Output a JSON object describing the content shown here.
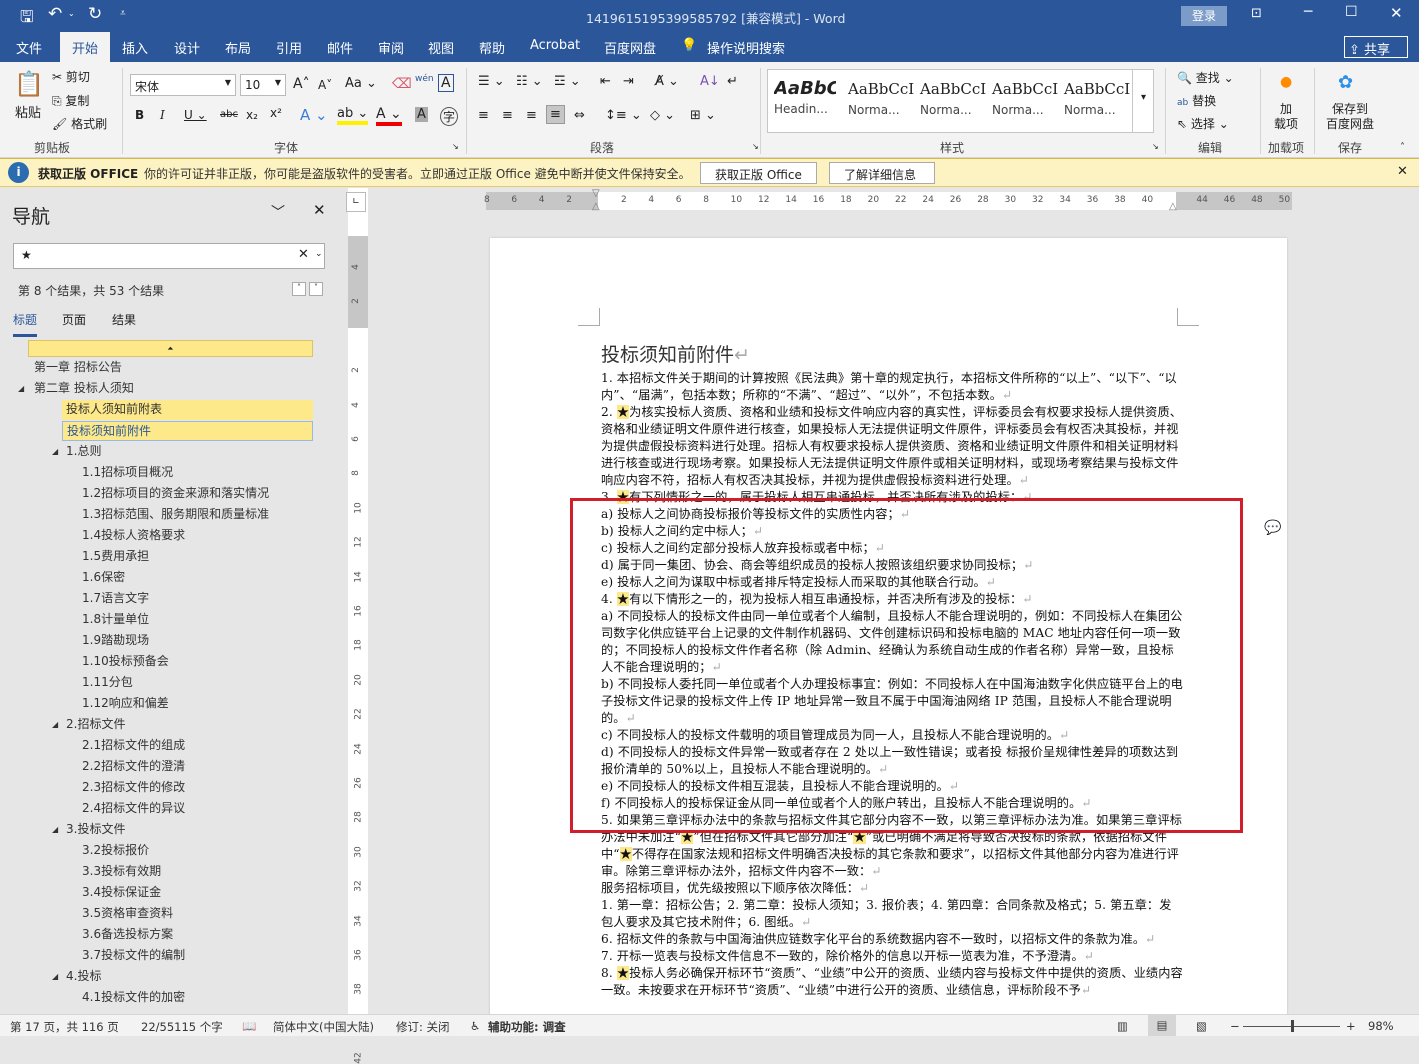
{
  "titlebar": {
    "doc_title": "1419615195399585792 [兼容模式]  -  Word",
    "login": "登录"
  },
  "tabs": [
    "文件",
    "开始",
    "插入",
    "设计",
    "布局",
    "引用",
    "邮件",
    "审阅",
    "视图",
    "帮助",
    "Acrobat",
    "百度网盘"
  ],
  "tell_me": "操作说明搜索",
  "share": "共享",
  "ribbon": {
    "clipboard": {
      "paste": "粘贴",
      "cut": "剪切",
      "copy": "复制",
      "format_painter": "格式刷",
      "label": "剪贴板"
    },
    "font": {
      "name": "宋体",
      "size": "10",
      "label": "字体",
      "aa": "Aa",
      "wen": "wén"
    },
    "paragraph": {
      "label": "段落"
    },
    "styles": {
      "label": "样式",
      "items": [
        {
          "preview": "AaBbC",
          "name": "Headin..."
        },
        {
          "preview": "AaBbCcI",
          "name": "Norma..."
        },
        {
          "preview": "AaBbCcI",
          "name": "Norma..."
        },
        {
          "preview": "AaBbCcI",
          "name": "Norma..."
        },
        {
          "preview": "AaBbCcI",
          "name": "Norma..."
        }
      ]
    },
    "editing": {
      "find": "查找",
      "replace": "替换",
      "select": "选择",
      "label": "编辑"
    },
    "addins": {
      "button": "加\n载项",
      "label": "加载项"
    },
    "save": {
      "button": "保存到\n百度网盘",
      "label": "保存"
    }
  },
  "message_bar": {
    "title": "获取正版 OFFICE",
    "text": "你的许可证并非正版，你可能是盗版软件的受害者。立即通过正版 Office 避免中断并使文件保持安全。",
    "btn_get": "获取正版 Office",
    "btn_learn": "了解详细信息"
  },
  "nav": {
    "title": "导航",
    "search_value": "★",
    "result_text": "第 8 个结果，共 53 个结果",
    "tabs": [
      "标题",
      "页面",
      "结果"
    ],
    "items": [
      {
        "label": "第一章 招标公告",
        "level": 0,
        "hl": false
      },
      {
        "label": "第二章 投标人须知",
        "level": 0,
        "hl": false,
        "exp": true
      },
      {
        "label": "投标人须知前附表",
        "level": 2,
        "hl": true
      },
      {
        "label": "投标须知前附件",
        "level": 2,
        "hl": true,
        "sel": true
      },
      {
        "label": "1.总则",
        "level": 1,
        "exp": true
      },
      {
        "label": "1.1招标项目概况",
        "level": 3
      },
      {
        "label": "1.2招标项目的资金来源和落实情况",
        "level": 3
      },
      {
        "label": "1.3招标范围、服务期限和质量标准",
        "level": 3
      },
      {
        "label": "1.4投标人资格要求",
        "level": 3
      },
      {
        "label": "1.5费用承担",
        "level": 3
      },
      {
        "label": "1.6保密",
        "level": 3
      },
      {
        "label": "1.7语言文字",
        "level": 3
      },
      {
        "label": "1.8计量单位",
        "level": 3
      },
      {
        "label": "1.9踏勘现场",
        "level": 3
      },
      {
        "label": "1.10投标预备会",
        "level": 3
      },
      {
        "label": "1.11分包",
        "level": 3
      },
      {
        "label": "1.12响应和偏差",
        "level": 3
      },
      {
        "label": "2.招标文件",
        "level": 1,
        "exp": true
      },
      {
        "label": "2.1招标文件的组成",
        "level": 3
      },
      {
        "label": "2.2招标文件的澄清",
        "level": 3
      },
      {
        "label": "2.3招标文件的修改",
        "level": 3
      },
      {
        "label": "2.4招标文件的异议",
        "level": 3
      },
      {
        "label": "3.投标文件",
        "level": 1,
        "exp": true
      },
      {
        "label": "3.2投标报价",
        "level": 3
      },
      {
        "label": "3.3投标有效期",
        "level": 3
      },
      {
        "label": "3.4投标保证金",
        "level": 3
      },
      {
        "label": "3.5资格审查资料",
        "level": 3
      },
      {
        "label": "3.6备选投标方案",
        "level": 3
      },
      {
        "label": "3.7投标文件的编制",
        "level": 3
      },
      {
        "label": "4.投标",
        "level": 1,
        "exp": true
      },
      {
        "label": "4.1投标文件的加密",
        "level": 3
      }
    ]
  },
  "ruler": {
    "h": [
      "8",
      "6",
      "4",
      "2",
      "",
      "2",
      "4",
      "6",
      "8",
      "10",
      "12",
      "14",
      "16",
      "18",
      "20",
      "22",
      "24",
      "26",
      "28",
      "30",
      "32",
      "34",
      "36",
      "38",
      "40",
      "",
      "44",
      "46",
      "48",
      "50"
    ],
    "v": [
      "4",
      "2",
      "",
      "2",
      "4",
      "6",
      "8",
      "10",
      "12",
      "14",
      "16",
      "18",
      "20",
      "22",
      "24",
      "26",
      "28",
      "30",
      "32",
      "34",
      "36",
      "38",
      "40",
      "42"
    ]
  },
  "doc": {
    "heading": "投标须知前附件",
    "paras": [
      "1. 本招标文件关于期间的计算按照《民法典》第十章的规定执行，本招标文件所称的“以上”、“以下”、“以内”、“届满”，包括本数；所称的“不满”、“超过”、“以外”，不包括本数。",
      "2. ★为核实投标人资质、资格和业绩和投标文件响应内容的真实性，评标委员会有权要求投标人提供资质、资格和业绩证明文件原件进行核查，如果投标人无法提供证明文件原件，评标委员会有权否决其投标，并视为提供虚假投标资料进行处理。招标人有权要求投标人提供资质、资格和业绩证明文件原件和相关证明材料进行核查或进行现场考察。如果投标人无法提供证明文件原件或相关证明材料，或现场考察结果与投标文件响应内容不符，招标人有权否决其投标，并视为提供虚假投标资料进行处理。",
      "3. ★有下列情形之一的，属于投标人相互串通投标，并否决所有涉及的投标：",
      "a)   投标人之间协商投标报价等投标文件的实质性内容；",
      "b)   投标人之间约定中标人；",
      "c)   投标人之间约定部分投标人放弃投标或者中标；",
      "d)   属于同一集团、协会、商会等组织成员的投标人按照该组织要求协同投标；",
      "e)   投标人之间为谋取中标或者排斥特定投标人而采取的其他联合行动。",
      "4. ★有以下情形之一的，视为投标人相互串通投标，并否决所有涉及的投标：",
      "a) 不同投标人的投标文件由同一单位或者个人编制，且投标人不能合理说明的，例如：不同投标人在集团公司数字化供应链平台上记录的文件制作机器码、文件创建标识码和投标电脑的 MAC 地址内容任何一项一致的；不同投标人的投标文件作者名称（除 Admin、经确认为系统自动生成的作者名称）异常一致，且投标人不能合理说明的；",
      "b) 不同投标人委托同一单位或者个人办理投标事宜：例如：不同投标人在中国海油数字化供应链平台上的电子投标文件记录的投标文件上传 IP 地址异常一致且不属于中国海油网络 IP 范围，且投标人不能合理说明的。",
      "c) 不同投标人的投标文件载明的项目管理成员为同一人，且投标人不能合理说明的。",
      "d) 不同投标人的投标文件异常一致或者存在 2 处以上一致性错误；或者投 标报价呈规律性差异的项数达到报价清单的 50%以上，且投标人不能合理说明的。",
      "e) 不同投标人的投标文件相互混装，且投标人不能合理说明的。",
      "f) 不同投标人的投标保证金从同一单位或者个人的账户转出，且投标人不能合理说明的。",
      "5. 如果第三章评标办法中的条款与招标文件其它部分内容不一致，以第三章评标办法为准。如果第三章评标办法中未加注“★”但在招标文件其它部分加注“★”或已明确不满足将导致否决投标的条款，依据招标文件中“★不得存在国家法规和招标文件明确否决投标的其它条款和要求”，以招标文件其他部分内容为准进行评审。除第三章评标办法外，招标文件内容不一致：",
      "服务招标项目，优先级按照以下顺序依次降低：",
      "1. 第一章：招标公告；2. 第二章：投标人须知；3. 报价表；4. 第四章：合同条款及格式；5. 第五章：发包人要求及其它技术附件；6. 图纸。",
      "6. 招标文件的条款与中国海油供应链数字化平台的系统数据内容不一致时，以招标文件的条款为准。",
      "7. 开标一览表与投标文件信息不一致的，除价格外的信息以开标一览表为准，不予澄清。",
      "8. ★投标人务必确保开标环节“资质”、“业绩”中公开的资质、业绩内容与投标文件中提供的资质、业绩内容一致。未按要求在开标环节“资质”、“业绩”中进行公开的资质、业绩信息，评标阶段不予"
    ]
  },
  "status": {
    "page": "第 17 页，共 116 页",
    "words": "22/55115 个字",
    "lang": "简体中文(中国大陆)",
    "track": "修订: 关闭",
    "access": "辅助功能: 调查",
    "zoom": "98%",
    "zoom_fraction": 0.49
  },
  "colors": {
    "accent": "#2b579a",
    "highlight": "#fde98a",
    "red_box": "#d21e2b"
  }
}
